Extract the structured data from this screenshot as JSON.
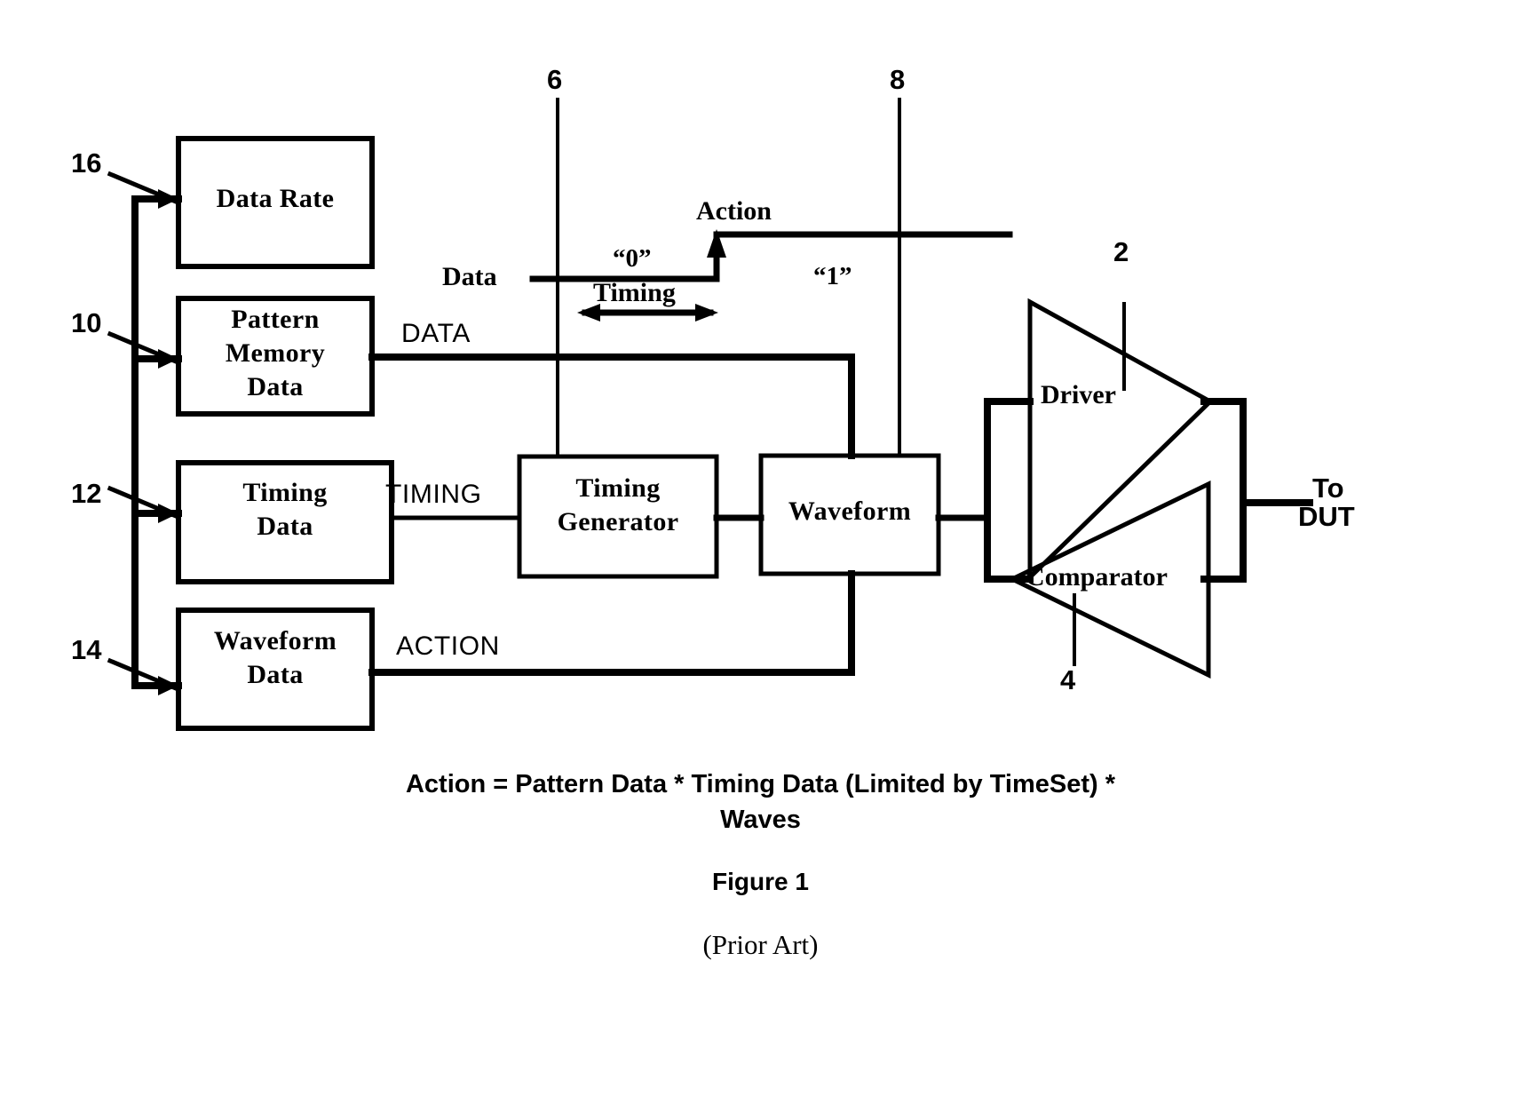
{
  "figure": {
    "title": "Figure 1",
    "subtitle": "(Prior Art)",
    "equation_line1": "Action = Pattern Data * Timing Data (Limited by TimeSet) *",
    "equation_line2": "Waves"
  },
  "blocks": [
    {
      "id": "data_rate",
      "label": "Data Rate",
      "ref": "16"
    },
    {
      "id": "pattern_memory",
      "label": "Pattern\nMemory\nData",
      "ref": "10"
    },
    {
      "id": "timing_data",
      "label": "Timing\nData",
      "ref": "12"
    },
    {
      "id": "waveform_data",
      "label": "Waveform\nData",
      "ref": "14"
    },
    {
      "id": "timing_gen",
      "label": "Timing\nGenerator",
      "ref": "6"
    },
    {
      "id": "waveform",
      "label": "Waveform",
      "ref": "8"
    }
  ],
  "block_labels": {
    "data_rate": "Data Rate",
    "pattern_memory_l1": "Pattern",
    "pattern_memory_l2": "Memory",
    "pattern_memory_l3": "Data",
    "timing_data_l1": "Timing",
    "timing_data_l2": "Data",
    "waveform_data_l1": "Waveform",
    "waveform_data_l2": "Data",
    "timing_gen_l1": "Timing",
    "timing_gen_l2": "Generator",
    "waveform": "Waveform"
  },
  "signals": {
    "data": "DATA",
    "timing": "TIMING",
    "action": "ACTION"
  },
  "refnums": {
    "r16": "16",
    "r10": "10",
    "r12": "12",
    "r14": "14",
    "r6": "6",
    "r8": "8",
    "r2": "2",
    "r4": "4"
  },
  "waveform_annotations": {
    "data_label": "Data",
    "action_label": "Action",
    "bit_low": "“0”",
    "bit_high": "“1”",
    "timing_span": "Timing"
  },
  "pin_electronics": {
    "driver": "Driver",
    "comparator": "Comparator",
    "dut_line1": "To",
    "dut_line2": "DUT"
  },
  "colors": {
    "ink": "#000000",
    "paper": "#ffffff"
  }
}
